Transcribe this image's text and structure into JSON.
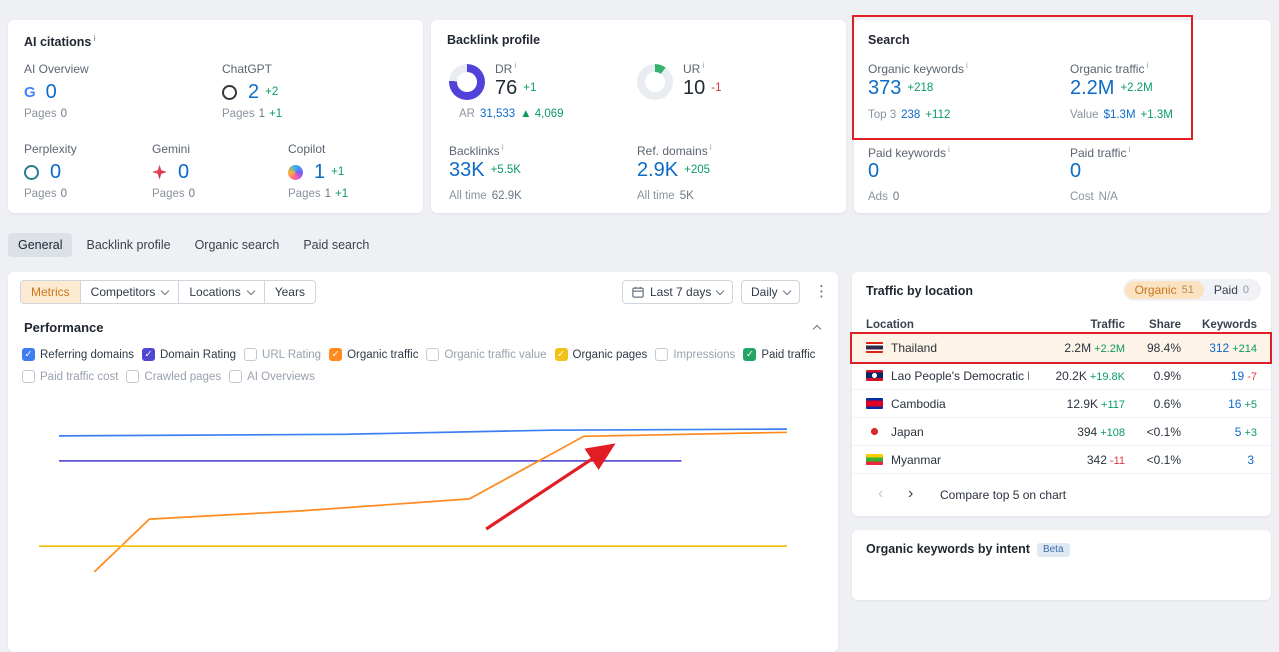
{
  "colors": {
    "link_blue": "#0d6bc8",
    "positive_green": "#0a9b63",
    "negative_red": "#d63a41",
    "accent_orange": "#cb7516",
    "annotation_red": "#e01e24"
  },
  "icons": {
    "info": "i",
    "kebab": "⋮",
    "prev": "‹",
    "next": "›",
    "up_triangle": "▲",
    "check": "✓",
    "google_letter": "G"
  },
  "ai_card": {
    "title": "AI citations",
    "items": [
      {
        "label": "AI Overview",
        "value": "0",
        "change": "",
        "pages_label": "Pages",
        "pages_value": "0",
        "pages_change": ""
      },
      {
        "label": "ChatGPT",
        "value": "2",
        "change": "+2",
        "pages_label": "Pages",
        "pages_value": "1",
        "pages_change": "+1"
      },
      {
        "label": "Perplexity",
        "value": "0",
        "change": "",
        "pages_label": "Pages",
        "pages_value": "0",
        "pages_change": ""
      },
      {
        "label": "Gemini",
        "value": "0",
        "change": "",
        "pages_label": "Pages",
        "pages_value": "0",
        "pages_change": ""
      },
      {
        "label": "Copilot",
        "value": "1",
        "change": "+1",
        "pages_label": "Pages",
        "pages_value": "1",
        "pages_change": "+1"
      }
    ]
  },
  "backlink_card": {
    "title": "Backlink profile",
    "dr": {
      "label": "DR",
      "value": "76",
      "change": "+1",
      "percent": 76,
      "color": "#5143d9",
      "ar_label": "AR",
      "ar_value": "31,533",
      "ar_change": "4,069"
    },
    "ur": {
      "label": "UR",
      "value": "10",
      "change": "-1",
      "percent": 10,
      "color": "#35b36b"
    },
    "backlinks": {
      "label": "Backlinks",
      "value": "33K",
      "change": "+5.5K",
      "alltime_label": "All time",
      "alltime_value": "62.9K"
    },
    "ref_domains": {
      "label": "Ref. domains",
      "value": "2.9K",
      "change": "+205",
      "alltime_label": "All time",
      "alltime_value": "5K"
    }
  },
  "search_card": {
    "title": "Search",
    "organic_keywords": {
      "label": "Organic keywords",
      "value": "373",
      "change": "+218",
      "sub_label": "Top 3",
      "sub_value": "238",
      "sub_change": "+112"
    },
    "organic_traffic": {
      "label": "Organic traffic",
      "value": "2.2M",
      "change": "+2.2M",
      "sub_label": "Value",
      "sub_value": "$1.3M",
      "sub_change": "+1.3M"
    },
    "paid_keywords": {
      "label": "Paid keywords",
      "value": "0",
      "sub_label": "Ads",
      "sub_value": "0"
    },
    "paid_traffic": {
      "label": "Paid traffic",
      "value": "0",
      "sub_label": "Cost",
      "sub_value": "N/A"
    }
  },
  "tabs": [
    {
      "label": "General",
      "active": true
    },
    {
      "label": "Backlink profile",
      "active": false
    },
    {
      "label": "Organic search",
      "active": false
    },
    {
      "label": "Paid search",
      "active": false
    }
  ],
  "toolbar": {
    "metrics": "Metrics",
    "competitors": "Competitors",
    "locations": "Locations",
    "years": "Years",
    "date_range": "Last 7 days",
    "granularity": "Daily"
  },
  "performance": {
    "title": "Performance",
    "metrics": [
      {
        "label": "Referring domains",
        "checked": true,
        "color": "#3d7ef2"
      },
      {
        "label": "Domain Rating",
        "checked": true,
        "color": "#4f46d2"
      },
      {
        "label": "URL Rating",
        "checked": false
      },
      {
        "label": "Organic traffic",
        "checked": true,
        "color": "#ff8a1e"
      },
      {
        "label": "Organic traffic value",
        "checked": false
      },
      {
        "label": "Organic pages",
        "checked": true,
        "color": "#f2c116"
      },
      {
        "label": "Impressions",
        "checked": false
      },
      {
        "label": "Paid traffic",
        "checked": true,
        "color": "#23a566"
      },
      {
        "label": "Paid traffic cost",
        "checked": false
      },
      {
        "label": "Crawled pages",
        "checked": false
      },
      {
        "label": "AI Overviews",
        "checked": false
      }
    ]
  },
  "chart_data": {
    "type": "line",
    "title": "Performance",
    "x_range_label": "Last 7 days",
    "granularity": "Daily",
    "grid": false,
    "axis_tick_labels_visible": false,
    "series": [
      {
        "name": "Referring domains",
        "color": "#3d7ef2",
        "points_pct": [
          [
            4.5,
            24.4
          ],
          [
            40,
            23.5
          ],
          [
            66,
            21.2
          ],
          [
            95.5,
            20.6
          ]
        ]
      },
      {
        "name": "Domain Rating",
        "color": "#5e55d6",
        "points_pct": [
          [
            4.5,
            38.3
          ],
          [
            82.3,
            38.3
          ]
        ]
      },
      {
        "name": "Organic traffic",
        "color": "#ff8a1e",
        "points_pct": [
          [
            8.9,
            100
          ],
          [
            15.8,
            70.6
          ],
          [
            34.5,
            66.1
          ],
          [
            55.8,
            59.4
          ],
          [
            70.1,
            24.6
          ],
          [
            95.5,
            22.4
          ]
        ]
      },
      {
        "name": "Organic pages",
        "color": "#f2c116",
        "points_pct": [
          [
            2,
            85.6
          ],
          [
            95.5,
            85.6
          ]
        ]
      }
    ],
    "annotation_arrow": {
      "from_pct": [
        57.9,
        76.1
      ],
      "to_pct": [
        73.4,
        30.5
      ],
      "color": "#e01e24"
    }
  },
  "traffic_by_location": {
    "title": "Traffic by location",
    "toggle": [
      {
        "label": "Organic",
        "count": "51",
        "active": true
      },
      {
        "label": "Paid",
        "count": "0",
        "active": false
      }
    ],
    "columns": [
      "Location",
      "Traffic",
      "Share",
      "Keywords"
    ],
    "rows": [
      {
        "location": "Thailand",
        "traffic": "2.2M",
        "traffic_change": "+2.2M",
        "share": "98.4%",
        "keywords": "312",
        "keywords_change": "+214"
      },
      {
        "location": "Lao People's Democratic Reput",
        "traffic": "20.2K",
        "traffic_change": "+19.8K",
        "share": "0.9%",
        "keywords": "19",
        "keywords_change": "-7"
      },
      {
        "location": "Cambodia",
        "traffic": "12.9K",
        "traffic_change": "+117",
        "share": "0.6%",
        "keywords": "16",
        "keywords_change": "+5"
      },
      {
        "location": "Japan",
        "traffic": "394",
        "traffic_change": "+108",
        "share": "<0.1%",
        "keywords": "5",
        "keywords_change": "+3"
      },
      {
        "location": "Myanmar",
        "traffic": "342",
        "traffic_change": "-11",
        "share": "<0.1%",
        "keywords": "3",
        "keywords_change": ""
      }
    ],
    "footer": {
      "compare_label": "Compare top 5 on chart"
    }
  },
  "intent_card": {
    "title": "Organic keywords by intent",
    "badge": "Beta"
  }
}
